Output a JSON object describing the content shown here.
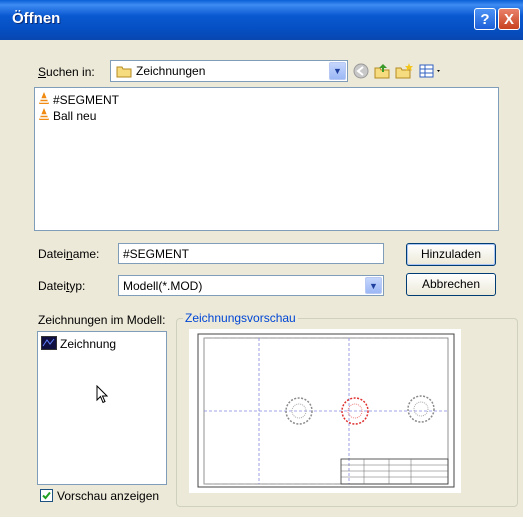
{
  "dialog": {
    "title": "Öffnen",
    "help_label": "?",
    "close_label": "X"
  },
  "lookin": {
    "label_pre": "",
    "label_accel": "S",
    "label_post": "uchen in:",
    "value": "Zeichnungen"
  },
  "files": [
    {
      "name": "#SEGMENT",
      "icon": "vlc-cone-icon"
    },
    {
      "name": "Ball neu",
      "icon": "vlc-cone-icon"
    }
  ],
  "filename": {
    "label_pre": "Datei",
    "label_accel": "n",
    "label_post": "ame:",
    "value": "#SEGMENT"
  },
  "filetype": {
    "label_pre": "Datei",
    "label_accel": "t",
    "label_post": "yp:",
    "value": "Modell(*.MOD)"
  },
  "buttons": {
    "load": "Hinzuladen",
    "cancel": "Abbrechen"
  },
  "drawings": {
    "label": "Zeichnungen im Modell:",
    "items": [
      {
        "name": "Zeichnung",
        "icon": "drawing-icon"
      }
    ]
  },
  "preview": {
    "label": "Zeichnungsvorschau",
    "show_label": "Vorschau anzeigen",
    "show_checked": true
  },
  "colors": {
    "title_blue": "#0a58d0",
    "group_label": "#0046d5",
    "preview_red": "#e03030",
    "preview_blue": "#4060e0"
  }
}
